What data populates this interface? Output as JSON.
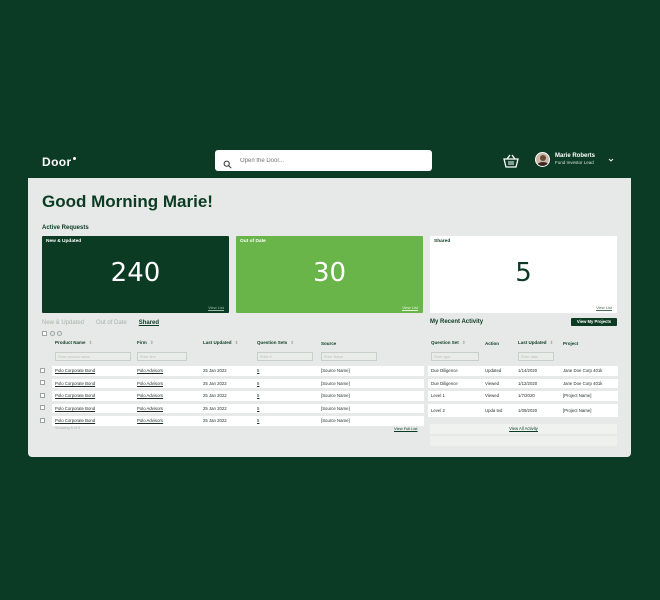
{
  "app": {
    "logo": "Door",
    "search_placeholder": "Open the Door...",
    "user": {
      "name": "Marie Roberts",
      "role": "Fund Investor Lead"
    }
  },
  "page": {
    "greeting": "Good Morning Marie!",
    "active_requests_label": "Active Requests"
  },
  "cards": [
    {
      "title": "New & Updated",
      "value": "240",
      "link": "View List"
    },
    {
      "title": "Out of Date",
      "value": "30",
      "link": "View List"
    },
    {
      "title": "Shared",
      "value": "5",
      "link": "View List"
    }
  ],
  "tabs": [
    "New & Updated",
    "Out of Date",
    "Shared"
  ],
  "products_table": {
    "columns": [
      "Product Name",
      "Firm",
      "Last Updated",
      "Question Sets",
      "Source"
    ],
    "filters": [
      "Enter product name",
      "Enter firm",
      "",
      "Enter #",
      "Enter Name"
    ],
    "rows": [
      [
        "Polo Corporate Bond",
        "Polo Advisors",
        "25 Jan 2022",
        "5",
        "[Source Name]"
      ],
      [
        "Polo Corporate Bond",
        "Polo Advisors",
        "25 Jan 2022",
        "5",
        "[Source Name]"
      ],
      [
        "Polo Corporate Bond",
        "Polo Advisors",
        "25 Jan 2022",
        "5",
        "[Source Name]"
      ],
      [
        "Polo Corporate Bond",
        "Polo Advisors",
        "25 Jan 2022",
        "5",
        "[Source Name]"
      ],
      [
        "Polo Corporate Bond",
        "Polo Advisors",
        "25 Jan 2022",
        "5",
        "[Source Name]"
      ]
    ],
    "showing": "Showing 5 of 5",
    "view_full": "View Full List"
  },
  "activity": {
    "title": "My Recent Activity",
    "projects_button": "View My Projects",
    "columns": [
      "Question Set",
      "Action",
      "Last Updated",
      "Project"
    ],
    "filters": [
      "Enter type",
      "",
      "Enter date",
      ""
    ],
    "rows": [
      [
        "Due Diligence",
        "Updated",
        "1/14/2020",
        "Jane Doe Corp 401k"
      ],
      [
        "Due Diligence",
        "Viewed",
        "1/12/2020",
        "Jane Doe Corp 401k"
      ],
      [
        "Level 1",
        "Viewed",
        "1/7/2020",
        "[Project Name]"
      ],
      [
        "Level 2",
        "Upda ted",
        "1/09/2020",
        "[Project Name]"
      ]
    ],
    "view_all": "View All Activity"
  },
  "colors": {
    "background": "#0b3b24",
    "card_dark": "#0c3b24",
    "card_green": "#6ab54a",
    "panel": "#e6e9e7"
  }
}
